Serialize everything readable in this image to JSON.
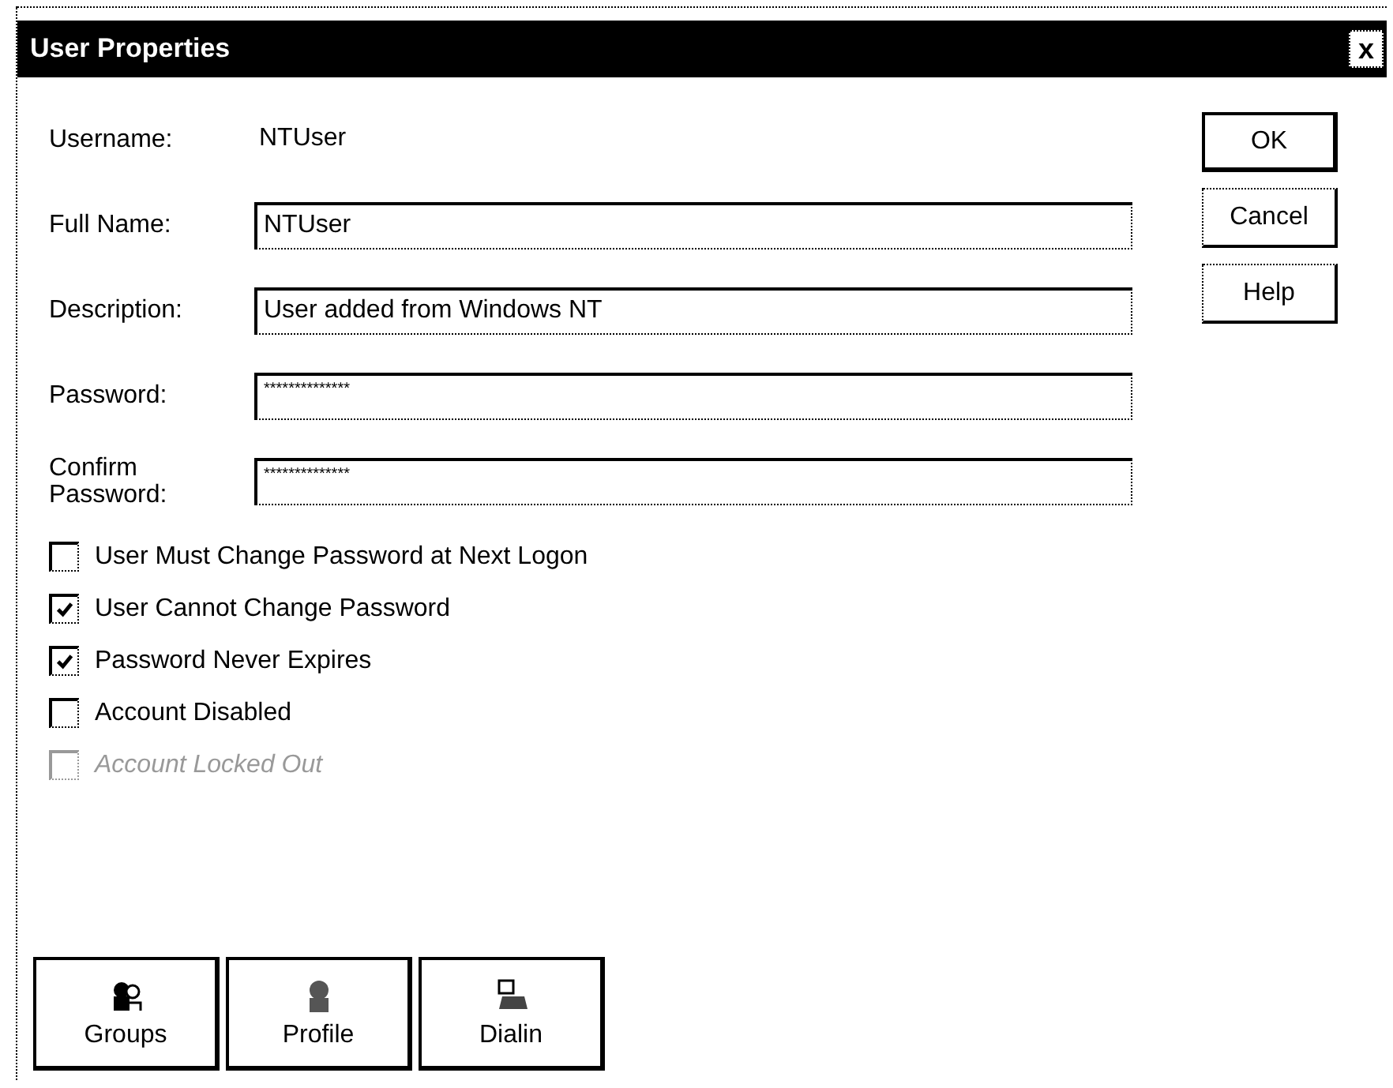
{
  "window": {
    "title": "User Properties",
    "close": "x"
  },
  "fields": [
    {
      "kind": "static",
      "label": "Username:",
      "value": "NTUser"
    },
    {
      "kind": "input",
      "label": "Full Name:",
      "value": "NTUser"
    },
    {
      "kind": "input",
      "label": "Description:",
      "value": "User added from Windows NT"
    },
    {
      "kind": "password",
      "label": "Password:",
      "value": "**************"
    },
    {
      "kind": "password",
      "label": "Confirm Password:",
      "value": "**************"
    }
  ],
  "checkboxes": [
    {
      "label": "User Must Change Password at Next Logon",
      "checked": false,
      "disabled": false
    },
    {
      "label": "User Cannot Change Password",
      "checked": true,
      "disabled": false
    },
    {
      "label": "Password Never Expires",
      "checked": true,
      "disabled": false
    },
    {
      "label": "Account Disabled",
      "checked": false,
      "disabled": false
    },
    {
      "label": "Account Locked Out",
      "checked": false,
      "disabled": true
    }
  ],
  "buttons": [
    {
      "label": "OK",
      "default": true
    },
    {
      "label": "Cancel",
      "default": false
    },
    {
      "label": "Help",
      "default": false
    }
  ],
  "bottom_buttons": [
    {
      "label": "Groups",
      "kind": "groups"
    },
    {
      "label": "Profile",
      "kind": "profile"
    },
    {
      "label": "Dialin",
      "kind": "dialin"
    }
  ]
}
